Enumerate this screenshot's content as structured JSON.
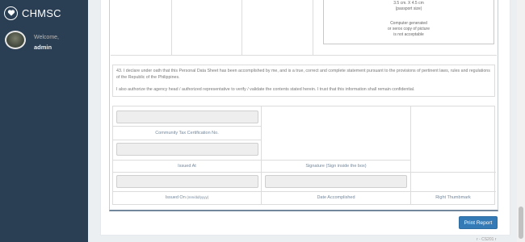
{
  "sidebar": {
    "brand": "CHMSC",
    "welcome_label": "Welcome,",
    "username": "admin"
  },
  "photo_box": {
    "size": "3.5 cm. X 4.5 cm",
    "size_note": "(passport size)",
    "note_line1": "Computer generated",
    "note_line2": "or xerox copy of picture",
    "note_line3": "is not acceptable"
  },
  "declaration": {
    "oath": "43. I declare under oath that this Personal Data Sheet has been accomplished by me, and is a true, correct and complete statement pursuant to the provisions of pertinent laws, rules and regulations of the Republic of the Philippines.",
    "authorize": "I also authorize the agency head / authorized representative to verify / validate the contents stated herein. I trust that this information shall remain confidential."
  },
  "form": {
    "ctc_label": "Community Tax Certification No.",
    "issued_at_label": "Issued At",
    "issued_on_label": "Issued On",
    "issued_on_hint": "(mm/dd/yyyy)",
    "signature_label": "Signature (Sign inside the box)",
    "date_label": "Date Accomplished",
    "thumbmark_label": "Right Thumbmark",
    "ctc_value": "",
    "issued_at_value": "",
    "issued_on_value": "",
    "date_value": ""
  },
  "actions": {
    "print_label": "Print Report"
  },
  "footer": {
    "hint": "r - CS201 r"
  },
  "colors": {
    "sidebar": "#2a3f54",
    "primary": "#337ab7",
    "label": "#73879c"
  }
}
